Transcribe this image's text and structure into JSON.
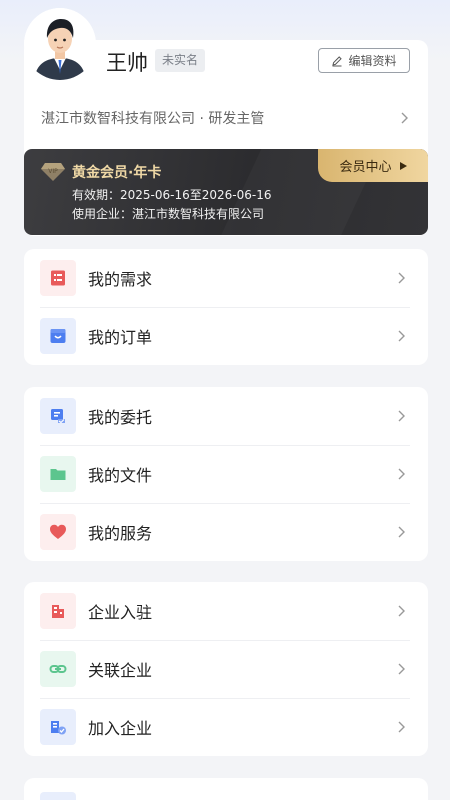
{
  "profile": {
    "name": "王帅",
    "realname_status": "未实名",
    "edit_label": "编辑资料",
    "company_line": "湛江市数智科技有限公司 · 研发主管"
  },
  "membership": {
    "title": "黄金会员·年卡",
    "validity": "有效期：2025-06-16至2026-06-16",
    "company": "使用企业：湛江市数智科技有限公司",
    "center_label": "会员中心"
  },
  "menu_groups": [
    {
      "items": [
        {
          "label": "我的需求",
          "icon": "demand-icon",
          "color": "#e85a5a",
          "bg": "#fdeeee"
        },
        {
          "label": "我的订单",
          "icon": "order-icon",
          "color": "#4d7ef0",
          "bg": "#e8eefc"
        }
      ]
    },
    {
      "items": [
        {
          "label": "我的委托",
          "icon": "entrust-icon",
          "color": "#4d7ef0",
          "bg": "#e8eefc"
        },
        {
          "label": "我的文件",
          "icon": "folder-icon",
          "color": "#5cc58e",
          "bg": "#e8f7ef"
        },
        {
          "label": "我的服务",
          "icon": "heart-icon",
          "color": "#e85a5a",
          "bg": "#fdeeee"
        }
      ]
    },
    {
      "items": [
        {
          "label": "企业入驻",
          "icon": "enterprise-settle-icon",
          "color": "#e85a5a",
          "bg": "#fdeeee"
        },
        {
          "label": "关联企业",
          "icon": "link-icon",
          "color": "#5cc58e",
          "bg": "#e8f7ef"
        },
        {
          "label": "加入企业",
          "icon": "join-enterprise-icon",
          "color": "#4d7ef0",
          "bg": "#e8eefc"
        }
      ]
    }
  ]
}
